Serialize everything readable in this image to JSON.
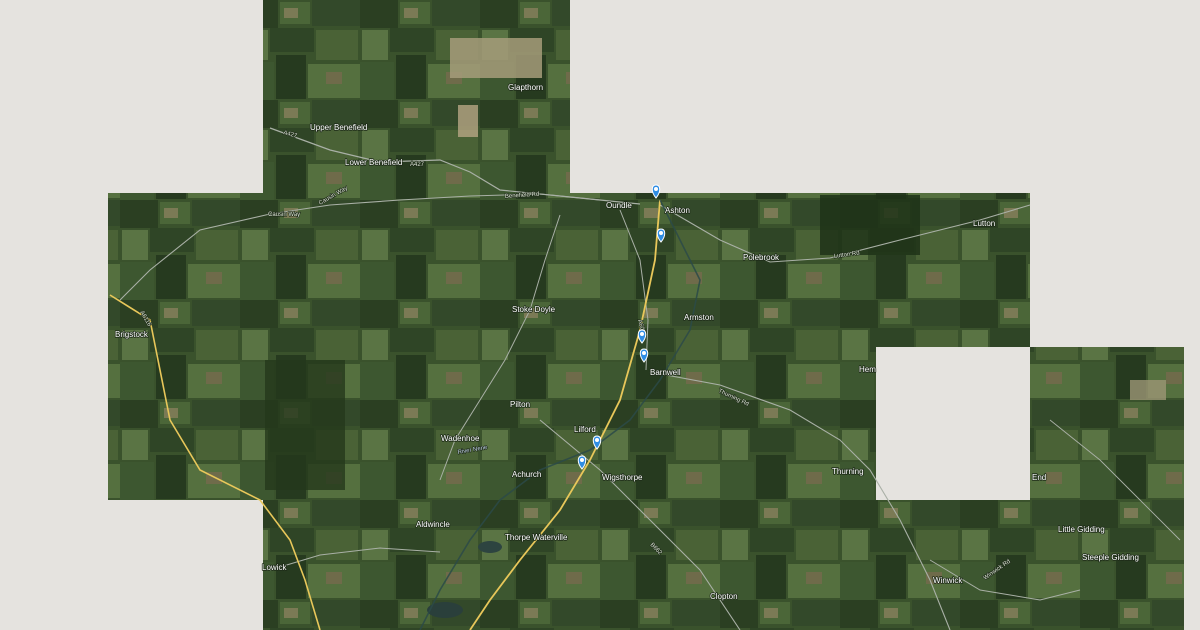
{
  "map": {
    "view": "satellite",
    "colors": {
      "background": "#e5e3df",
      "field_dark": "#2b3f22",
      "field_mid": "#3f5a30",
      "field_light": "#5e7a47",
      "road_minor": "#9aa39a",
      "road_major": "#e8c75a",
      "marker": "#2f8de4"
    },
    "places": {
      "glapthorn": "Glapthorn",
      "upper_benefield": "Upper Benefield",
      "lower_benefield": "Lower Benefield",
      "oundle": "Oundle",
      "ashton": "Ashton",
      "polebrook": "Polebrook",
      "lutton": "Lutton",
      "brigstock": "Brigstock",
      "stoke_doyle": "Stoke Doyle",
      "armston": "Armston",
      "barnwell": "Barnwell",
      "hemington": "Hem",
      "pilton": "Pilton",
      "wadenhoe": "Wadenhoe",
      "lilford": "Lilford",
      "achurch": "Achurch",
      "wigsthorpe": "Wigsthorpe",
      "thurning": "Thurning",
      "aldwincle": "Aldwincle",
      "thorpe_waterville": "Thorpe Waterville",
      "lowick": "Lowick",
      "clopton": "Clopton",
      "winwick": "Winwick",
      "little_gidding": "Little Gidding",
      "steeple_gidding": "Steeple Gidding",
      "end": "End"
    },
    "roads": {
      "a427_west": "A427",
      "a427_east": "A427",
      "benefield_rd": "Benefield Rd",
      "causin_way": "Causin Way",
      "lutton_rd": "Lutton Rd",
      "a6116": "A6116",
      "a605": "A605",
      "b662": "B662",
      "thurning_rd": "Thurning Rd",
      "winwick_rd": "Winwick Rd",
      "river_nene": "River Nene"
    },
    "markers": [
      {
        "id": "marker-1",
        "label": "Location marker"
      },
      {
        "id": "marker-2",
        "label": "Location marker"
      },
      {
        "id": "marker-3",
        "label": "Location marker"
      },
      {
        "id": "marker-4",
        "label": "Location marker"
      },
      {
        "id": "marker-5",
        "label": "Location marker"
      },
      {
        "id": "marker-6",
        "label": "Location marker"
      }
    ]
  }
}
